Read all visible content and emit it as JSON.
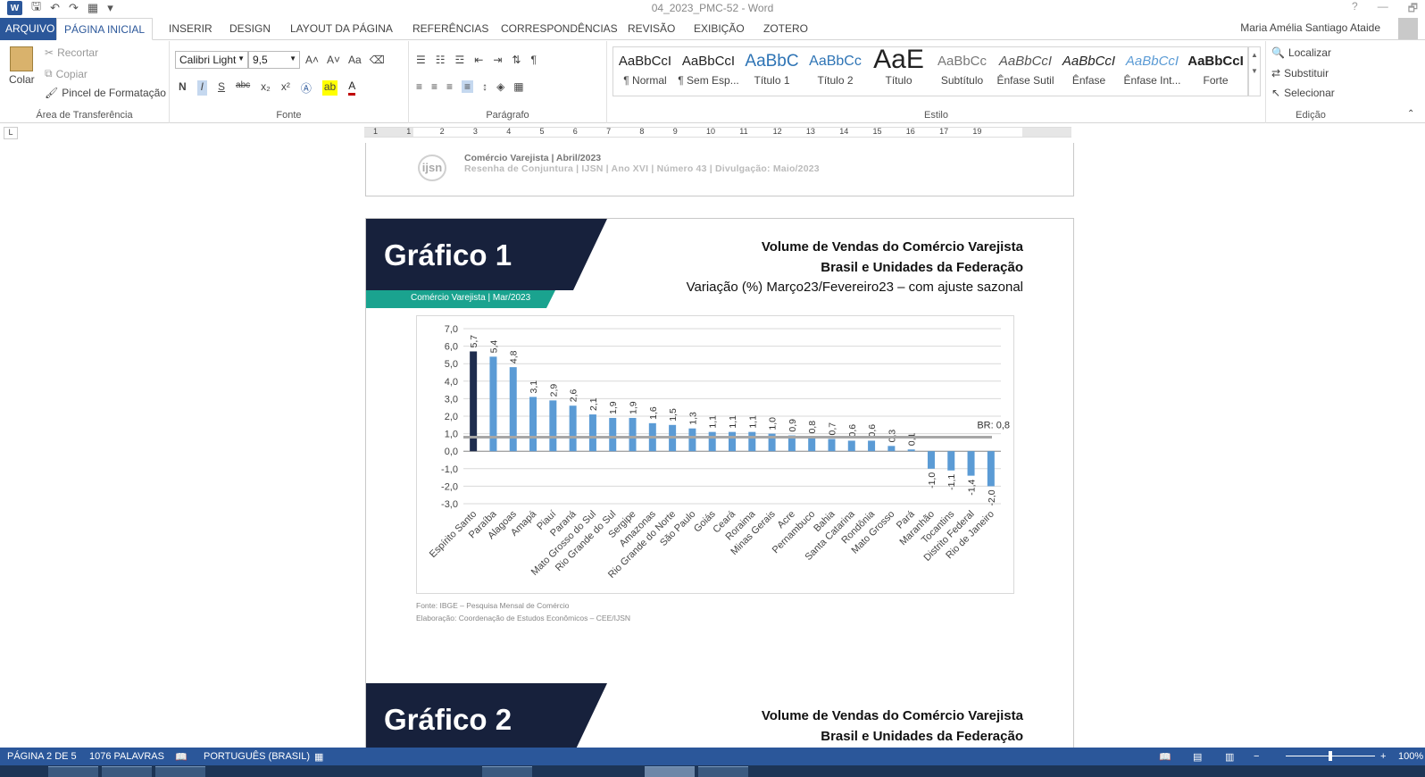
{
  "window": {
    "title": "04_2023_PMC-52 - Word",
    "app_logo": "W",
    "help": "?",
    "restore": "🗗",
    "minimize": "—"
  },
  "tabs": [
    "ARQUIVO",
    "PÁGINA INICIAL",
    "INSERIR",
    "DESIGN",
    "LAYOUT DA PÁGINA",
    "REFERÊNCIAS",
    "CORRESPONDÊNCIAS",
    "REVISÃO",
    "EXIBIÇÃO",
    "ZOTERO"
  ],
  "user": "Maria Amélia Santiago Ataide",
  "clipboard": {
    "paste": "Colar",
    "cut": "Recortar",
    "copy": "Copiar",
    "format_painter": "Pincel de Formatação",
    "label": "Área de Transferência"
  },
  "font": {
    "family": "Calibri Light",
    "size": "9,5",
    "grow": "A˄",
    "shrink": "A˅",
    "case": "Aa",
    "bold": "N",
    "italic": "I",
    "underline": "S",
    "strike": "abc",
    "subscript": "x₂",
    "superscript": "x²",
    "label": "Fonte"
  },
  "paragraph": {
    "label": "Parágrafo",
    "pilcrow": "¶"
  },
  "styles": {
    "label": "Estilo",
    "items": [
      {
        "preview": "AaBbCcI",
        "name": "¶ Normal"
      },
      {
        "preview": "AaBbCcI",
        "name": "¶ Sem Esp..."
      },
      {
        "preview": "AaBbC",
        "name": "Título 1"
      },
      {
        "preview": "AaBbCc",
        "name": "Título 2"
      },
      {
        "preview": "AaE",
        "name": "Título"
      },
      {
        "preview": "AaBbCc",
        "name": "Subtítulo"
      },
      {
        "preview": "AaBbCcI",
        "name": "Ênfase Sutil"
      },
      {
        "preview": "AaBbCcI",
        "name": "Ênfase"
      },
      {
        "preview": "AaBbCcI",
        "name": "Ênfase Int..."
      },
      {
        "preview": "AaBbCcI",
        "name": "Forte"
      }
    ]
  },
  "editing": {
    "label": "Edição",
    "find": "Localizar",
    "replace": "Substituir",
    "select": "Selecionar"
  },
  "ruler": {
    "corner": "L",
    "numbers": [
      "1",
      "1",
      "2",
      "3",
      "4",
      "5",
      "6",
      "7",
      "8",
      "9",
      "10",
      "11",
      "12",
      "13",
      "14",
      "15",
      "16",
      "17",
      "19"
    ]
  },
  "page_header": {
    "logo": "ijsn",
    "line1": "Comércio Varejista | Abril/2023",
    "line2": "Resenha de Conjuntura | IJSN | Ano XVI | Número 43 | Divulgação: Maio/2023"
  },
  "grafico1": {
    "title": "Gráfico 1",
    "tag": "Comércio Varejista | Mar/2023",
    "heading1": "Volume de Vendas do Comércio Varejista",
    "heading2": "Brasil e Unidades da Federação",
    "heading3": "Variação (%) Março23/Fevereiro23 – com ajuste sazonal",
    "source1": "Fonte: IBGE – Pesquisa Mensal de Comércio",
    "source2": "Elaboração: Coordenação de Estudos Econômicos – CEE/IJSN"
  },
  "grafico2": {
    "title": "Gráfico 2",
    "heading1": "Volume de Vendas do Comércio Varejista",
    "heading2": "Brasil e Unidades da Federação"
  },
  "chart_data": {
    "type": "bar",
    "categories": [
      "Espírito Santo",
      "Paraíba",
      "Alagoas",
      "Amapá",
      "Piauí",
      "Paraná",
      "Mato Grosso do Sul",
      "Rio Grande do Sul",
      "Sergipe",
      "Amazonas",
      "Rio Grande do Norte",
      "São Paulo",
      "Goiás",
      "Ceará",
      "Roraima",
      "Minas Gerais",
      "Acre",
      "Pernambuco",
      "Bahia",
      "Santa Catarina",
      "Rondônia",
      "Mato Grosso",
      "Pará",
      "Maranhão",
      "Tocantins",
      "Distrito Federal",
      "Rio de Janeiro"
    ],
    "values": [
      5.7,
      5.4,
      4.8,
      3.1,
      2.9,
      2.6,
      2.1,
      1.9,
      1.9,
      1.6,
      1.5,
      1.3,
      1.1,
      1.1,
      1.1,
      1.0,
      0.9,
      0.8,
      0.7,
      0.6,
      0.6,
      0.3,
      0.1,
      -1.0,
      -1.1,
      -1.4,
      -2.0
    ],
    "value_labels": [
      "5,7",
      "5,4",
      "4,8",
      "3,1",
      "2,9",
      "2,6",
      "2,1",
      "1,9",
      "1,9",
      "1,6",
      "1,5",
      "1,3",
      "1,1",
      "1,1",
      "1,1",
      "1,0",
      "0,9",
      "0,8",
      "0,7",
      "0,6",
      "0,6",
      "0,3",
      "0,1",
      "-1,0",
      "-1,1",
      "-1,4",
      "-2,0"
    ],
    "y_ticks": [
      "7,0",
      "6,0",
      "5,0",
      "4,0",
      "3,0",
      "2,0",
      "1,0",
      "0,0",
      "-1,0",
      "-2,0",
      "-3,0"
    ],
    "ylim": [
      -3,
      7
    ],
    "reference_line": {
      "label": "BR: 0,8",
      "value": 0.8,
      "color": "#a6a6a6"
    },
    "highlight_color": "#1f2d4e",
    "bar_color": "#5b9bd5",
    "grid": true
  },
  "statusbar": {
    "page": "PÁGINA 2 DE 5",
    "words": "1076 PALAVRAS",
    "language": "PORTUGUÊS (BRASIL)",
    "zoom": "100%",
    "zoom_minus": "−",
    "zoom_plus": "+"
  },
  "colors": {
    "word_blue": "#2b579a",
    "navy": "#17213c",
    "teal": "#1aa38f"
  }
}
